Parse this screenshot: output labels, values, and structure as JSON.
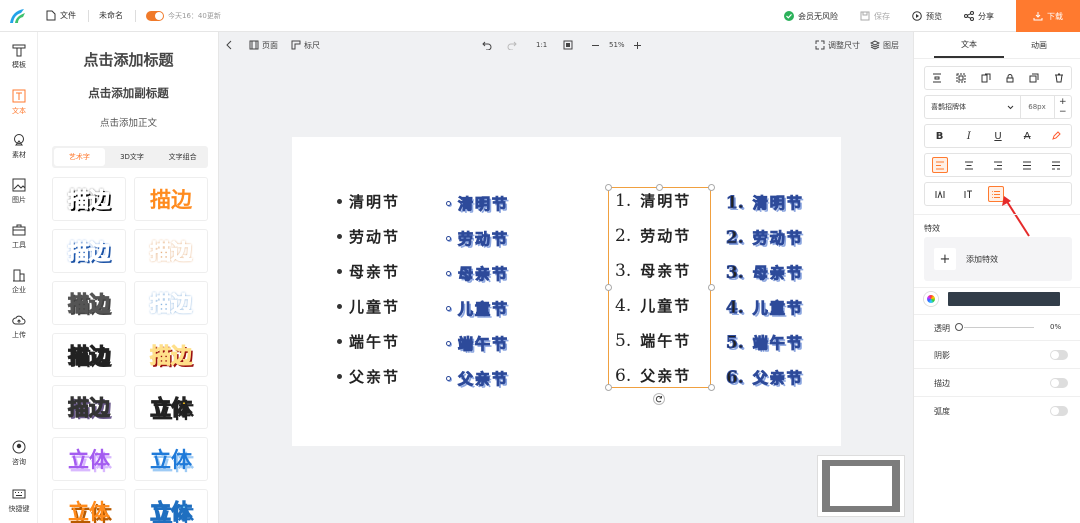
{
  "topbar": {
    "file_label": "文件",
    "doc_name": "未命名",
    "autosave_text": "今天16：40更新",
    "risk_label": "会员无风险",
    "save_label": "保存",
    "preview_label": "预览",
    "share_label": "分享",
    "download_label": "下载"
  },
  "rail": {
    "items": [
      {
        "label": "模板",
        "icon": "template-icon"
      },
      {
        "label": "文本",
        "icon": "text-icon"
      },
      {
        "label": "素材",
        "icon": "material-icon"
      },
      {
        "label": "图片",
        "icon": "image-icon"
      },
      {
        "label": "工具",
        "icon": "toolbox-icon"
      },
      {
        "label": "企业",
        "icon": "enterprise-icon"
      },
      {
        "label": "上传",
        "icon": "upload-icon"
      },
      {
        "label": "咨询",
        "icon": "headset-icon"
      },
      {
        "label": "快捷键",
        "icon": "keyboard-icon"
      }
    ]
  },
  "text_panel": {
    "add_title": "点击添加标题",
    "add_subtitle": "点击添加副标题",
    "add_body": "点击添加正文",
    "tabs": [
      "艺术字",
      "3D文字",
      "文字组合"
    ],
    "cards": [
      "描边",
      "描边",
      "描边",
      "描边",
      "描边",
      "描边",
      "描边",
      "描边",
      "描边",
      "描边",
      "描边",
      "立体",
      "立体",
      "立体",
      "立体",
      "立体"
    ]
  },
  "canvas_toolbar": {
    "page_label": "页面",
    "ruler_label": "标尺",
    "ratio": "1:1",
    "zoom": "51%",
    "resize_label": "调整尺寸",
    "layer_label": "图层"
  },
  "canvas": {
    "holidays": [
      "清明节",
      "劳动节",
      "母亲节",
      "儿童节",
      "端午节",
      "父亲节"
    ],
    "numbers": [
      "1.",
      "2.",
      "3.",
      "4.",
      "5.",
      "6."
    ]
  },
  "right_panel": {
    "tab_text": "文本",
    "tab_animation": "动画",
    "font_name": "喜鹊招牌体",
    "font_size": "68px",
    "effects_title": "特效",
    "add_effect": "添加特效",
    "color_hex": "#323d49",
    "opacity_label": "透明",
    "opacity_value": "0%",
    "shadow_label": "阴影",
    "stroke_label": "描边",
    "curve_label": "弧度"
  },
  "colors": {
    "accent": "#ff7a2f",
    "selection": "#f0a040",
    "fancy_stroke": "#2d4a9a"
  }
}
